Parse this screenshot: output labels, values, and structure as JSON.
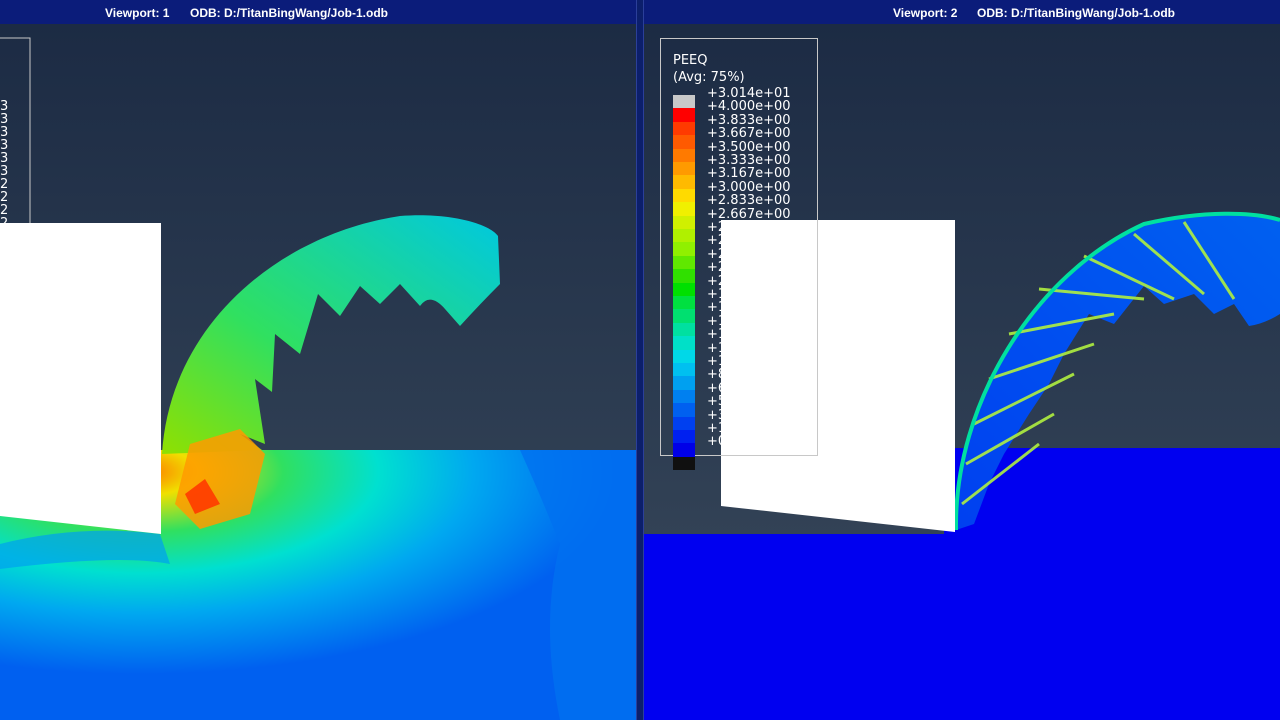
{
  "viewport1": {
    "title": "Viewport: 1",
    "odb": "ODB: D:/TitanBingWang/Job-1.odb",
    "legend_fragment_digits": [
      "3",
      "3",
      "3",
      "3",
      "3",
      "3",
      "2",
      "2",
      "2",
      "2",
      "2"
    ]
  },
  "viewport2": {
    "title": "Viewport: 2",
    "odb": "ODB: D:/TitanBingWang/Job-1.odb",
    "legend": {
      "title": "PEEQ",
      "subtitle": "(Avg: 75%)",
      "labels": [
        "+3.014e+01",
        "+4.000e+00",
        "+3.833e+00",
        "+3.667e+00",
        "+3.500e+00",
        "+3.333e+00",
        "+3.167e+00",
        "+3.000e+00",
        "+2.833e+00",
        "+2.667e+00",
        "+2",
        "+2",
        "+2",
        "+2",
        "+2",
        "+1",
        "+1",
        "+1",
        "+1",
        "+1",
        "+1",
        "+8",
        "+6",
        "+5",
        "+3",
        "+1",
        "+0"
      ],
      "colors": [
        "#c8c8c8",
        "#ff0000",
        "#ff3a00",
        "#ff5a00",
        "#ff7a00",
        "#ff9a00",
        "#ffba00",
        "#ffda00",
        "#f0f000",
        "#d0f000",
        "#b0f000",
        "#90f000",
        "#60e800",
        "#30e000",
        "#00e000",
        "#00e040",
        "#00e070",
        "#00e0a0",
        "#00e0c8",
        "#00d8e8",
        "#00c0f0",
        "#00a0f0",
        "#0080f0",
        "#0060f0",
        "#0040f0",
        "#0020f0",
        "#0000e8",
        "#101010"
      ]
    }
  },
  "colors": {
    "title_bar": "#0b1c7a",
    "background_top": "#1c2b44",
    "background_bottom": "#3a4a5c",
    "undeformed_block": "#ffffff",
    "low_strain": "#0050ff",
    "mid_strain": "#00ff80",
    "high_strain": "#ff4000"
  }
}
